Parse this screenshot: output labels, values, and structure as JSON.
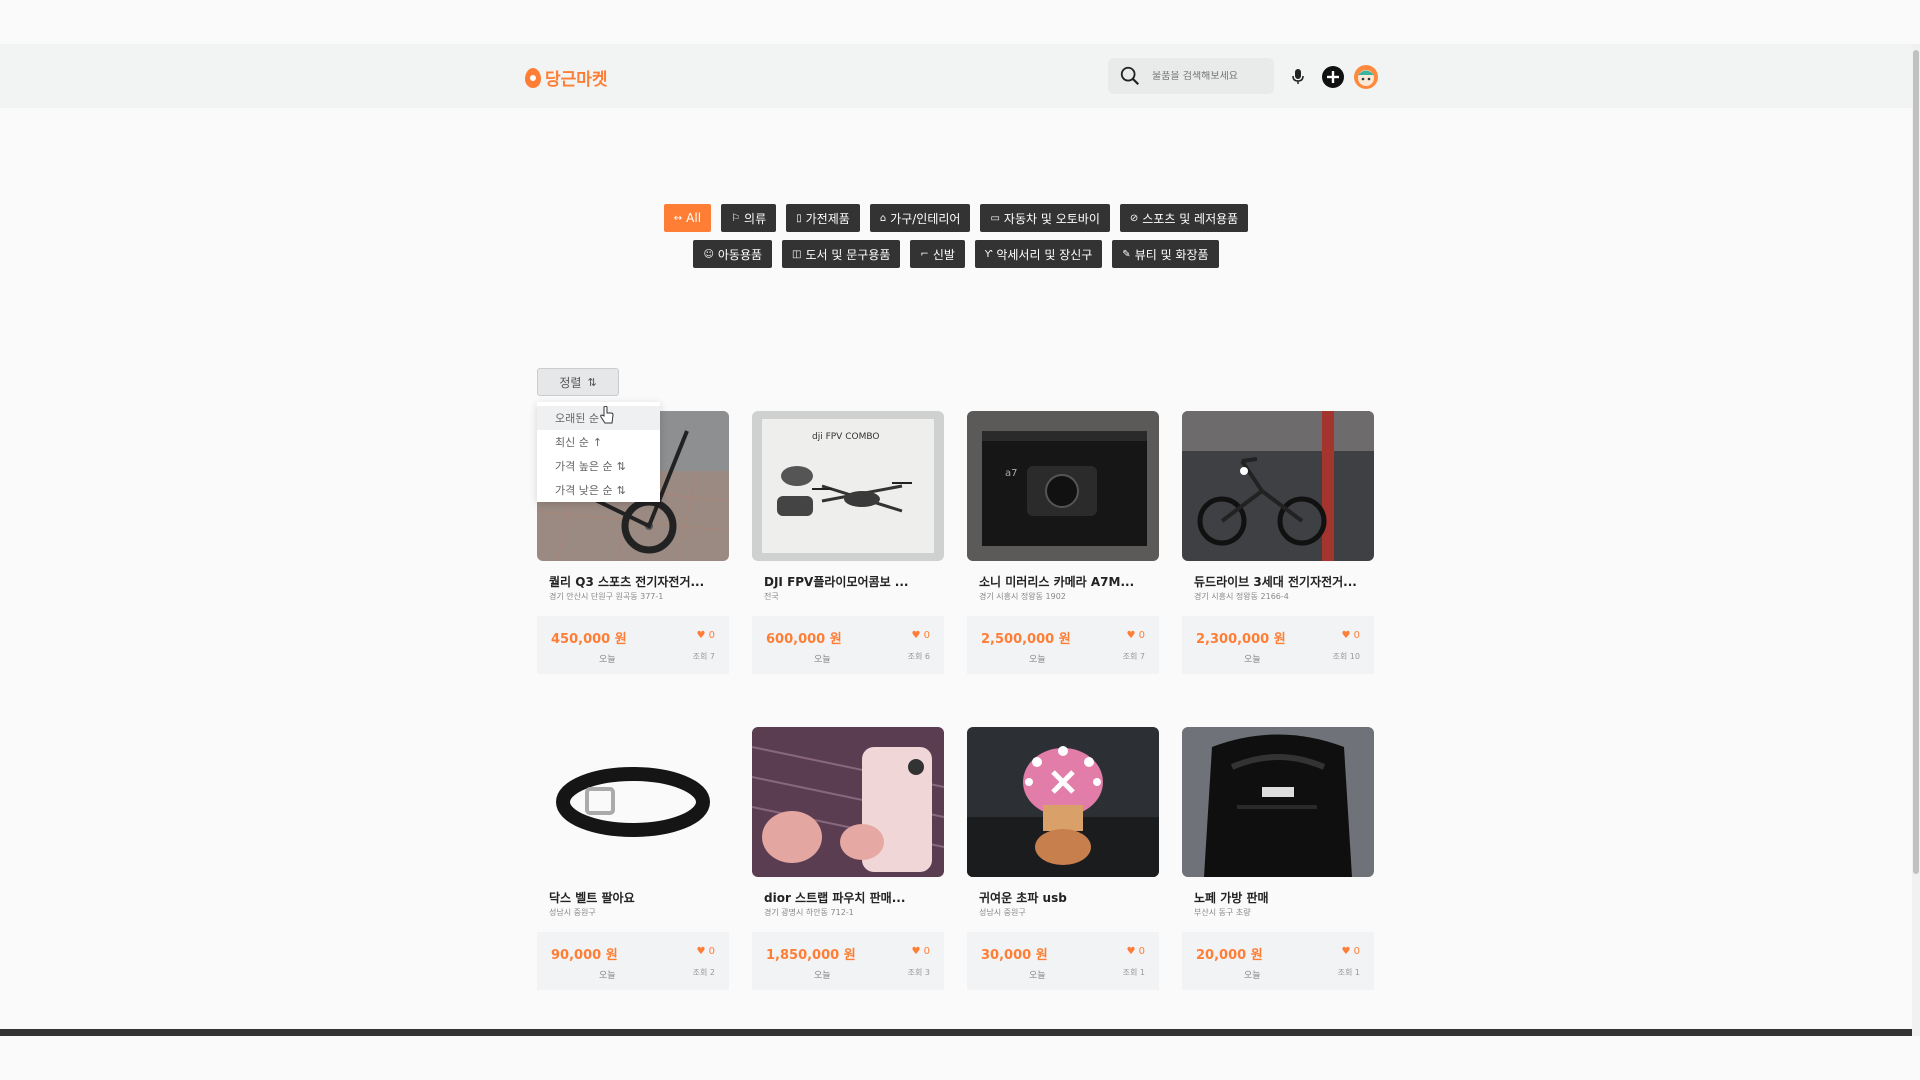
{
  "header": {
    "logo_text": "당근마켓",
    "search_placeholder": "물품을 검색해보세요",
    "icons": [
      "search-icon",
      "mic-icon",
      "plus-icon",
      "avatar"
    ]
  },
  "categories": {
    "row1": [
      {
        "label": "All",
        "icon": "all-icon",
        "active": true
      },
      {
        "label": "의류",
        "icon": "clothes-icon"
      },
      {
        "label": "가전제품",
        "icon": "phone-icon"
      },
      {
        "label": "가구/인테리어",
        "icon": "home-icon"
      },
      {
        "label": "자동차 및 오토바이",
        "icon": "car-icon"
      },
      {
        "label": "스포츠 및 레저용품",
        "icon": "ball-icon"
      }
    ],
    "row2": [
      {
        "label": "아동용품",
        "icon": "baby-icon"
      },
      {
        "label": "도서 및 문구용품",
        "icon": "book-icon"
      },
      {
        "label": "신발",
        "icon": "shoe-icon"
      },
      {
        "label": "악세서리 및 장신구",
        "icon": "accessory-icon"
      },
      {
        "label": "뷰티 및 화장품",
        "icon": "brush-icon"
      }
    ]
  },
  "sort": {
    "label": "정렬",
    "options": [
      "오래된 순",
      "최신 순",
      "가격 높은 순",
      "가격 낮은 순"
    ],
    "hovered": "오래된 순"
  },
  "products": [
    {
      "title": "퀄리 Q3 스포츠 전기자전거...",
      "location": "경기 안산시 단원구 원곡동 377-1",
      "price": "450,000 원",
      "likes": "0",
      "date": "오늘",
      "views": "조회 7",
      "image": "bike-q3"
    },
    {
      "title": "DJI FPV플라이모어콤보 ...",
      "location": "전국",
      "price": "600,000 원",
      "likes": "0",
      "date": "오늘",
      "views": "조회 6",
      "image": "drone"
    },
    {
      "title": "소니 미러리스 카메라 A7M...",
      "location": "경기 시흥시 정왕동 1902",
      "price": "2,500,000 원",
      "likes": "0",
      "date": "오늘",
      "views": "조회 7",
      "image": "camera"
    },
    {
      "title": "듀드라이브 3세대 전기자전거...",
      "location": "경기 시흥시 정왕동 2166-4",
      "price": "2,300,000 원",
      "likes": "0",
      "date": "오늘",
      "views": "조회 10",
      "image": "ebike"
    },
    {
      "title": "닥스 벨트 팔아요",
      "location": "성남시 중원구",
      "price": "90,000 원",
      "likes": "0",
      "date": "오늘",
      "views": "조회 2",
      "image": "belt"
    },
    {
      "title": "dior 스트랩 파우치 판매...",
      "location": "경기 광명시 하안동 712-1",
      "price": "1,850,000 원",
      "likes": "0",
      "date": "오늘",
      "views": "조회 3",
      "image": "dior"
    },
    {
      "title": "귀여운 초파 usb",
      "location": "성남시 중원구",
      "price": "30,000 원",
      "likes": "0",
      "date": "오늘",
      "views": "조회 1",
      "image": "chopper"
    },
    {
      "title": "노페 가방 판매",
      "location": "부산시 동구 초량",
      "price": "20,000 원",
      "likes": "0",
      "date": "오늘",
      "views": "조회 1",
      "image": "backpack"
    }
  ],
  "colors": {
    "accent": "#ff7e36",
    "category_bg": "#333333"
  }
}
